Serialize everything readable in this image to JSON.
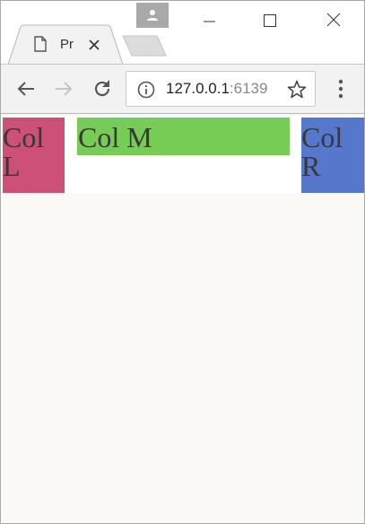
{
  "browser": {
    "tab": {
      "title": "Pr",
      "favicon": "page-icon"
    },
    "address_bar": {
      "host": "127.0.0.1",
      "port": ":6139"
    },
    "icons": {
      "back": "back-arrow-icon",
      "forward": "forward-arrow-icon",
      "reload": "reload-icon",
      "info": "info-icon",
      "bookmark": "star-icon",
      "menu": "kebab-menu-icon",
      "profile": "person-icon"
    }
  },
  "page": {
    "columns": {
      "left": {
        "label": "Col L",
        "color": "#cc5077"
      },
      "middle": {
        "label": "Col M",
        "color": "#77cc55"
      },
      "right": {
        "label": "Col R",
        "color": "#5577cc"
      }
    }
  }
}
